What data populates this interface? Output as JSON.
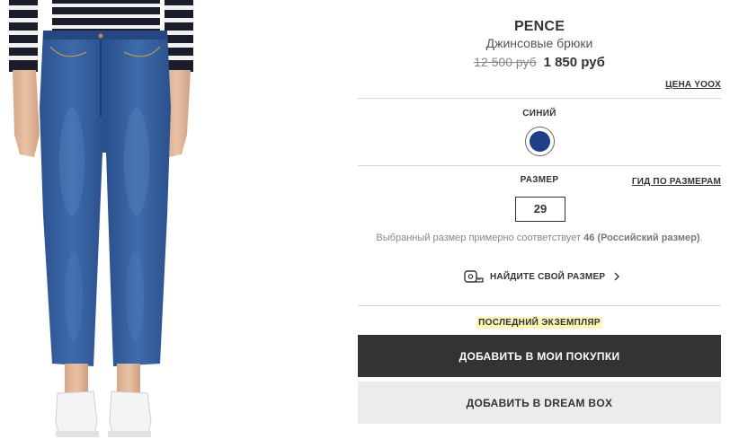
{
  "product": {
    "brand": "PENCE",
    "type": "Джинсовые брюки",
    "old_price": "12 500 руб",
    "new_price": "1 850 руб",
    "price_link": "ЦЕНА YOOX",
    "image_icon": "jeans-product-photo"
  },
  "color": {
    "label": "СИНИЙ",
    "swatch_color": "#1f3f88"
  },
  "size": {
    "label": "РАЗМЕР",
    "guide_link": "ГИД ПО РАЗМЕРАМ",
    "selected": "29",
    "note_prefix": "Выбранный размер примерно соответствует ",
    "note_value": "46 (Российский размер)",
    "note_suffix": ".",
    "find_label": "НАЙДИТЕ СВОЙ РАЗМЕР",
    "find_icon": "measuring-tape-icon",
    "find_chevron": "chevron-right-icon"
  },
  "stock": {
    "label": "ПОСЛЕДНИЙ ЭКЗЕМПЛЯР",
    "highlight_color": "#fbf6b5"
  },
  "actions": {
    "add_to_cart": "ДОБАВИТЬ В МОИ ПОКУПКИ",
    "add_to_dreambox": "ДОБАВИТЬ В DREAM BOX"
  }
}
